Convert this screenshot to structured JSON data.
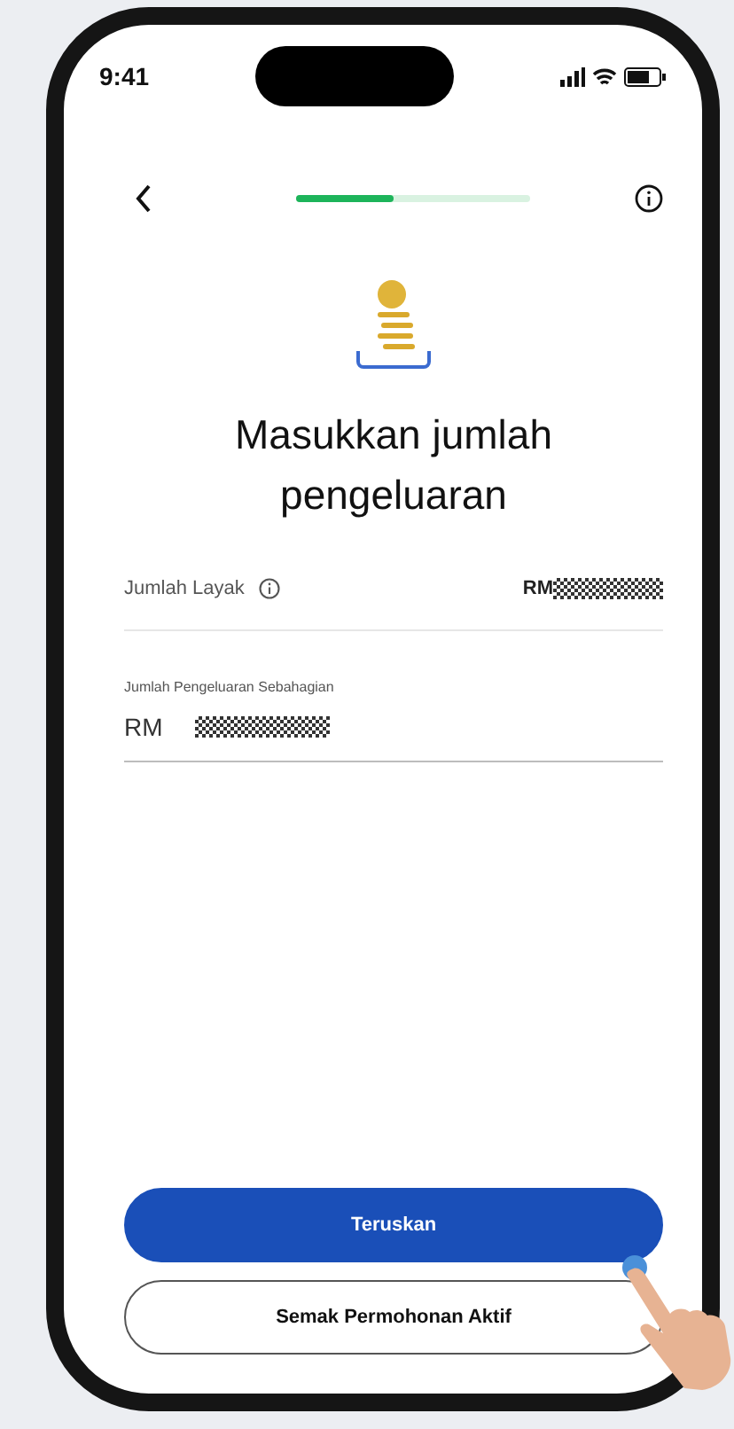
{
  "status_bar": {
    "time": "9:41"
  },
  "progress": {
    "level": 0.42
  },
  "title": "Masukkan jumlah pengeluaran",
  "eligible": {
    "label": "Jumlah Layak",
    "currency": "RM"
  },
  "amount_field": {
    "label": "Jumlah Pengeluaran Sebahagian",
    "currency": "RM"
  },
  "buttons": [
    {
      "label": "Teruskan",
      "kind": "primary"
    },
    {
      "label": "Semak Permohonan Aktif",
      "kind": "outline"
    }
  ]
}
